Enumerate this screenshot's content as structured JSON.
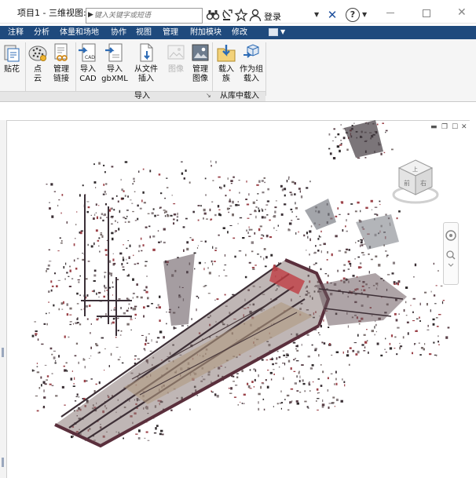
{
  "title_bar": {
    "title": "项目1 - 三维视图: {",
    "search": {
      "placeholder": "键入关键字或短语"
    },
    "icons": [
      "binoculars-icon",
      "satellite-icon",
      "star-icon",
      "user-icon"
    ],
    "login_label": "登录",
    "help_icon": "help-icon"
  },
  "menu": {
    "tabs": [
      "注释",
      "分析",
      "体量和场地",
      "协作",
      "视图",
      "管理",
      "附加模块",
      "修改"
    ]
  },
  "ribbon": {
    "buttons": [
      {
        "id": "paste",
        "label": "贴花"
      },
      {
        "id": "point-cloud",
        "label": "点\n云"
      },
      {
        "id": "manage-links",
        "label": "管理\n链接"
      },
      {
        "id": "import-cad",
        "label": "导入\nCAD",
        "icon_text": "CAD"
      },
      {
        "id": "import-gbxml",
        "label": "导入\ngbXML"
      },
      {
        "id": "insert-from-file",
        "label": "从文件\n插入"
      },
      {
        "id": "image",
        "label": "图像",
        "disabled": true
      },
      {
        "id": "manage-images",
        "label": "管理\n图像"
      },
      {
        "id": "load-family",
        "label": "载入\n族"
      },
      {
        "id": "load-as-group",
        "label": "作为组\n载入"
      }
    ],
    "panels": [
      {
        "id": "import",
        "label": "导入"
      },
      {
        "id": "load-from-library",
        "label": "从库中载入"
      }
    ]
  },
  "viewcube": {
    "top_face": "上",
    "front_face": "前",
    "right_face": "右"
  },
  "colors": {
    "menubar": "#1f4a7d",
    "ribbon": "#f5f5f5",
    "accent": "#1e4f9c"
  }
}
